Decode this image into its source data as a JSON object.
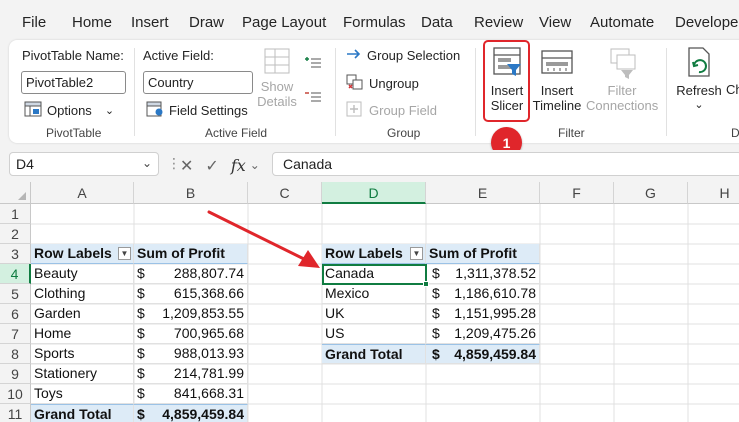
{
  "menu": [
    "File",
    "Home",
    "Insert",
    "Draw",
    "Page Layout",
    "Formulas",
    "Data",
    "Review",
    "View",
    "Automate",
    "Developer"
  ],
  "ribbon": {
    "pivottable": {
      "name_label": "PivotTable Name:",
      "name_value": "PivotTable2",
      "options_label": "Options",
      "group_label": "PivotTable"
    },
    "active_field": {
      "label": "Active Field:",
      "value": "Country",
      "field_settings_label": "Field Settings",
      "show_details_line1": "Show",
      "show_details_line2": "Details",
      "group_label": "Active Field"
    },
    "group": {
      "group_selection_label": "Group Selection",
      "ungroup_label": "Ungroup",
      "group_field_label": "Group Field",
      "group_label": "Group"
    },
    "filter": {
      "insert_slicer_line1": "Insert",
      "insert_slicer_line2": "Slicer",
      "insert_timeline_line1": "Insert",
      "insert_timeline_line2": "Timeline",
      "filter_connections_line1": "Filter",
      "filter_connections_line2": "Connections",
      "group_label": "Filter"
    },
    "data": {
      "refresh_label": "Refresh",
      "change_label": "Ch",
      "group_label": "Da"
    }
  },
  "step_badge": "1",
  "formula_bar": {
    "name_box": "D4",
    "formula": "Canada",
    "fx": "fx"
  },
  "grid": {
    "columns": [
      "A",
      "B",
      "C",
      "D",
      "E",
      "F",
      "G",
      "H"
    ],
    "rows": [
      "1",
      "2",
      "3",
      "4",
      "5",
      "6",
      "7",
      "8",
      "9",
      "10",
      "11"
    ],
    "currency_symbol": "$"
  },
  "pivot1": {
    "header_labels": "Row Labels",
    "header_sum": "Sum of Profit",
    "rows": [
      {
        "label": "Beauty",
        "value": "288,807.74"
      },
      {
        "label": "Clothing",
        "value": "615,368.66"
      },
      {
        "label": "Garden",
        "value": "1,209,853.55"
      },
      {
        "label": "Home",
        "value": "700,965.68"
      },
      {
        "label": "Sports",
        "value": "988,013.93"
      },
      {
        "label": "Stationery",
        "value": "214,781.99"
      },
      {
        "label": "Toys",
        "value": "841,668.31"
      }
    ],
    "total_label": "Grand Total",
    "total_value": "4,859,459.84"
  },
  "pivot2": {
    "header_labels": "Row Labels",
    "header_sum": "Sum of Profit",
    "rows": [
      {
        "label": "Canada",
        "value": "1,311,378.52"
      },
      {
        "label": "Mexico",
        "value": "1,186,610.78"
      },
      {
        "label": "UK",
        "value": "1,151,995.28"
      },
      {
        "label": "US",
        "value": "1,209,475.26"
      }
    ],
    "total_label": "Grand Total",
    "total_value": "4,859,459.84"
  },
  "colors": {
    "accent_green": "#107c41",
    "annotation_red": "#e0262b",
    "pivot_fill": "#ddebf7"
  }
}
